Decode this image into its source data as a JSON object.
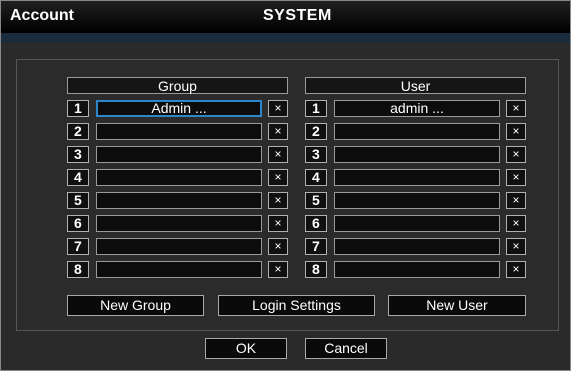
{
  "window": {
    "title": "Account",
    "section": "SYSTEM"
  },
  "group": {
    "header": "Group",
    "rows": [
      {
        "num": "1",
        "name": "Admin ...",
        "remove": "×"
      },
      {
        "num": "2",
        "name": "",
        "remove": "×"
      },
      {
        "num": "3",
        "name": "",
        "remove": "×"
      },
      {
        "num": "4",
        "name": "",
        "remove": "×"
      },
      {
        "num": "5",
        "name": "",
        "remove": "×"
      },
      {
        "num": "6",
        "name": "",
        "remove": "×"
      },
      {
        "num": "7",
        "name": "",
        "remove": "×"
      },
      {
        "num": "8",
        "name": "",
        "remove": "×"
      }
    ]
  },
  "user": {
    "header": "User",
    "rows": [
      {
        "num": "1",
        "name": "admin ...",
        "remove": "×"
      },
      {
        "num": "2",
        "name": "",
        "remove": "×"
      },
      {
        "num": "3",
        "name": "",
        "remove": "×"
      },
      {
        "num": "4",
        "name": "",
        "remove": "×"
      },
      {
        "num": "5",
        "name": "",
        "remove": "×"
      },
      {
        "num": "6",
        "name": "",
        "remove": "×"
      },
      {
        "num": "7",
        "name": "",
        "remove": "×"
      },
      {
        "num": "8",
        "name": "",
        "remove": "×"
      }
    ]
  },
  "actions": {
    "new_group": "New Group",
    "login_settings": "Login Settings",
    "new_user": "New User"
  },
  "footer": {
    "ok": "OK",
    "cancel": "Cancel"
  },
  "colors": {
    "selection": "#2c86c9",
    "background": "#2a2a2a"
  }
}
